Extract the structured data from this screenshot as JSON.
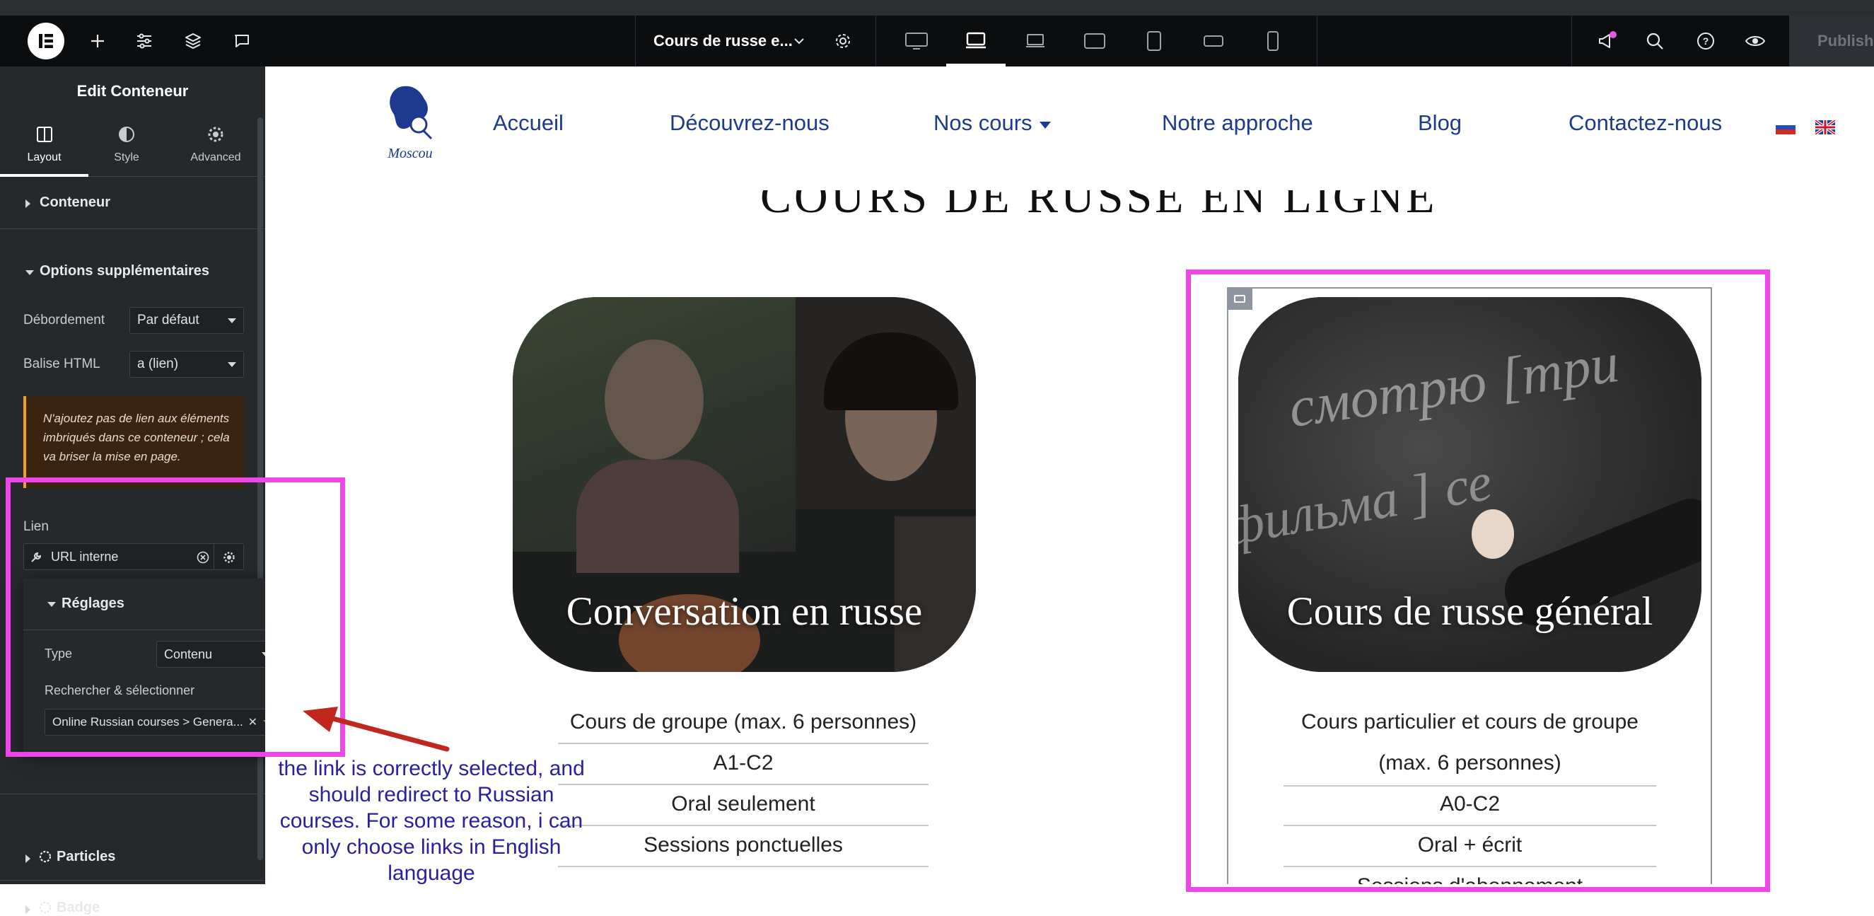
{
  "topbar": {
    "page_title": "Cours de russe e...",
    "publish_label": "Publish"
  },
  "panel": {
    "title": "Edit Conteneur",
    "tabs": [
      {
        "label": "Layout"
      },
      {
        "label": "Style"
      },
      {
        "label": "Advanced"
      }
    ],
    "section_conteneur": "Conteneur",
    "section_options": "Options supplémentaires",
    "debordement_label": "Débordement",
    "debordement_value": "Par défaut",
    "balise_label": "Balise HTML",
    "balise_value": "a (lien)",
    "warning": "N'ajoutez pas de lien aux éléments imbriqués dans ce conteneur ; cela va briser la mise en page.",
    "lien_label": "Lien",
    "lien_value": "URL interne",
    "popup": {
      "title": "Réglages",
      "type_label": "Type",
      "type_value": "Contenu",
      "search_label": "Rechercher & sélectionner",
      "search_value": "Online Russian courses > Genera..."
    },
    "section_particles": "Particles",
    "section_badge": "Badge"
  },
  "site": {
    "logo_text": "Moscou",
    "nav": [
      "Accueil",
      "Découvrez-nous",
      "Nos cours",
      "Notre approche",
      "Blog",
      "Contactez-nous"
    ],
    "heading_partial": "COURS DE RUSSE EN LIGNE",
    "cards": [
      {
        "title": "Conversation en russe",
        "rows": [
          "Cours de groupe (max. 6 personnes)",
          "A1-C2",
          "Oral seulement",
          "Sessions ponctuelles"
        ]
      },
      {
        "title": "Cours de russe général",
        "rows": [
          "Cours particulier et cours de groupe",
          "(max. 6 personnes)",
          "A0-C2",
          "Oral + écrit",
          "Sessions d'abonnement"
        ]
      }
    ],
    "chalk_text_1": "смотрю [три",
    "chalk_text_2": "фильма ] се"
  },
  "annotation": "the link is correctly selected, and should redirect to Russian courses. For some reason, i can only choose links in English language",
  "colors": {
    "accent": "#f045e8",
    "annotation_text": "#2a1fa0",
    "arrow": "#c0281e",
    "nav_text": "#1d3a8f"
  }
}
